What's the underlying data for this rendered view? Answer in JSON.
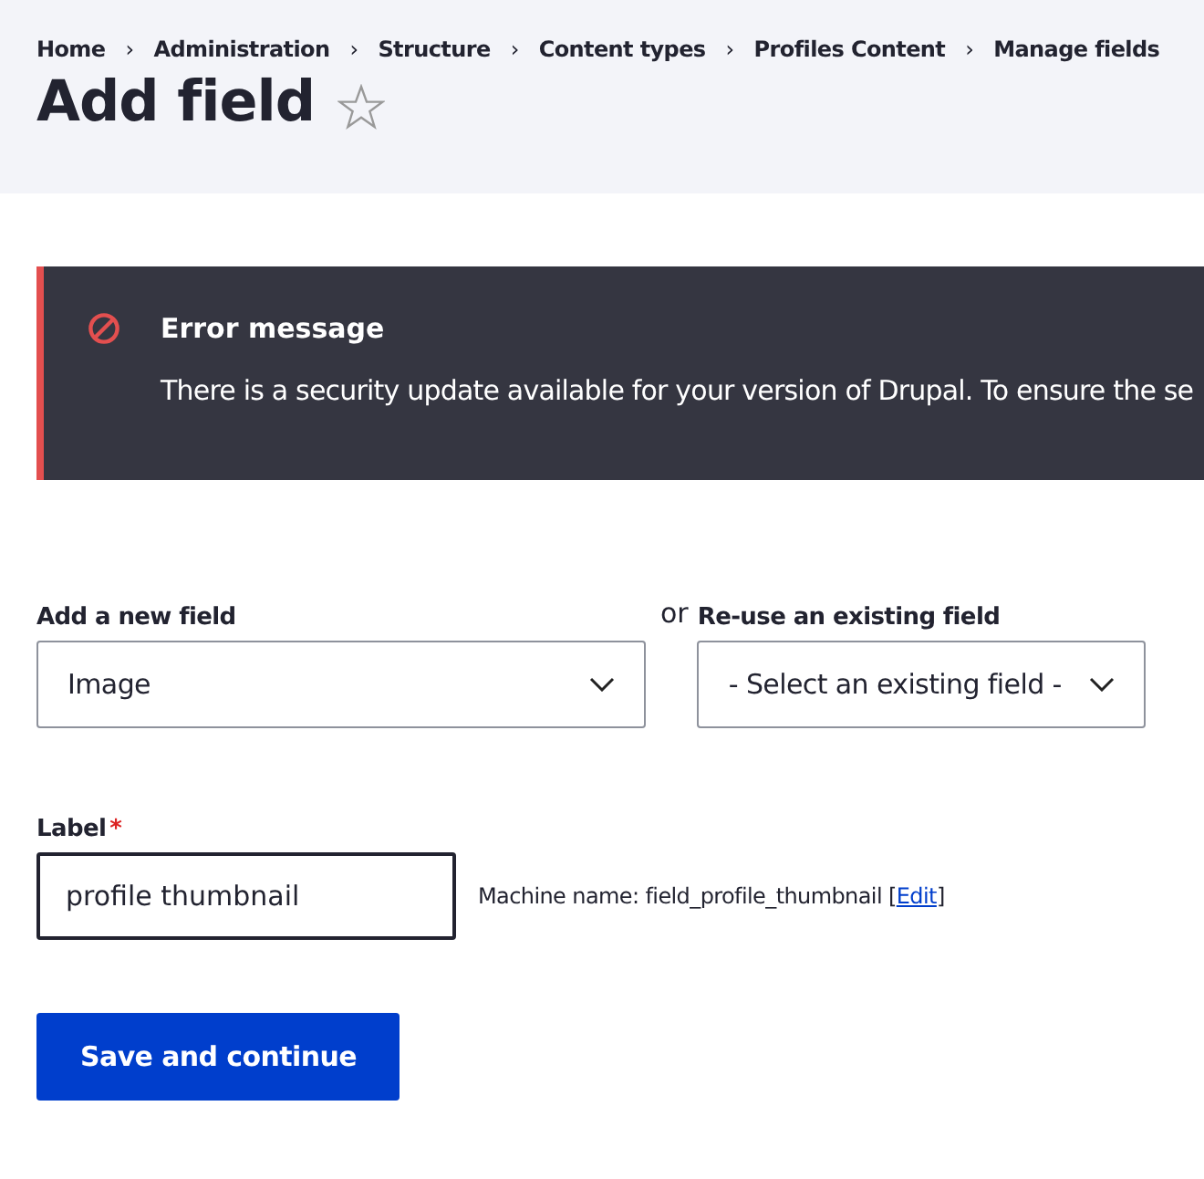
{
  "breadcrumb": [
    {
      "label": "Home",
      "separator": "›"
    },
    {
      "label": "Administration",
      "separator": "›"
    },
    {
      "label": "Structure",
      "separator": "›"
    },
    {
      "label": "Content types",
      "separator": "›"
    },
    {
      "label": "Profiles Content",
      "separator": "›"
    },
    {
      "label": "Manage fields"
    }
  ],
  "page_title": "Add field",
  "message": {
    "kind": "error",
    "title": "Error message",
    "text": "There is a security update available for your version of Drupal. To ensure the se"
  },
  "new_field": {
    "label": "Add a new field",
    "value": "Image"
  },
  "separator_text": "or",
  "existing_field": {
    "label": "Re-use an existing field",
    "value": "- Select an existing field -"
  },
  "label_field": {
    "label": "Label",
    "required": true,
    "required_mark": "*",
    "value": "profile thumbnail",
    "machine_name": "Machine name: field_profile_thumbnail",
    "link_open": "[",
    "link": "Edit",
    "link_close": "]"
  },
  "submit": {
    "label": "Save and continue"
  }
}
